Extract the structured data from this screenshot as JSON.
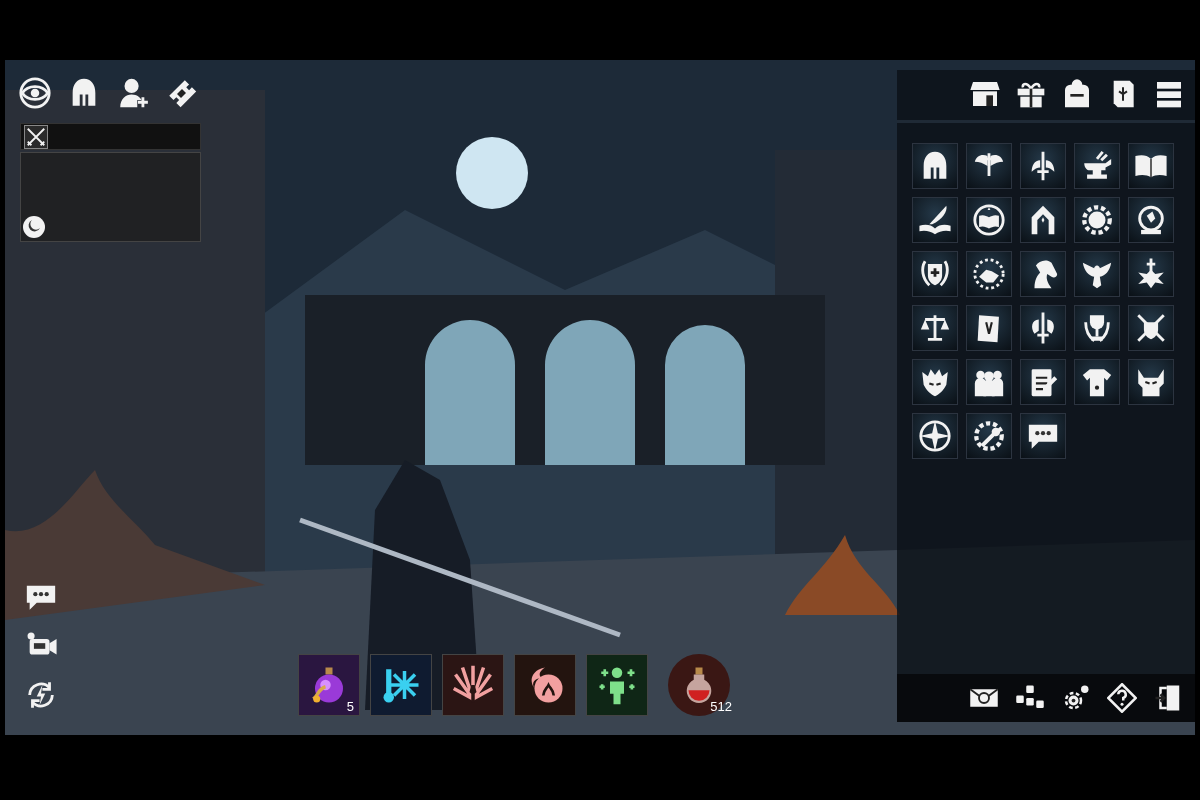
{
  "hotbar": [
    {
      "kind": "square",
      "color": "#2a1640",
      "count": "5"
    },
    {
      "kind": "square",
      "color": "#0f1b30"
    },
    {
      "kind": "square",
      "color": "#2b1514"
    },
    {
      "kind": "square",
      "color": "#23140f"
    },
    {
      "kind": "square",
      "color": "#0f2616"
    },
    {
      "kind": "round",
      "color": "#3a1714",
      "count": "512"
    }
  ]
}
